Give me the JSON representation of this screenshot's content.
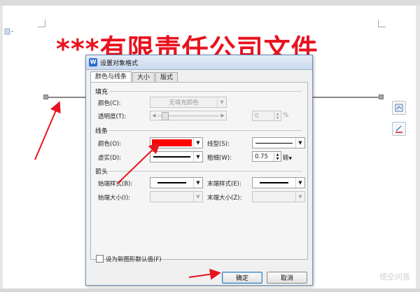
{
  "document": {
    "title_text": "***有限责任公司文件"
  },
  "dialog": {
    "title": "设置对象格式",
    "app_icon_letter": "W",
    "tabs": [
      {
        "label": "颜色与线条",
        "active": true
      },
      {
        "label": "大小",
        "active": false
      },
      {
        "label": "版式",
        "active": false
      }
    ],
    "fill": {
      "group_label": "填充",
      "color_label": "颜色(C):",
      "color_value": "无填充颜色",
      "transparency_label": "透明度(T):",
      "transparency_value": "0",
      "transparency_unit": "%"
    },
    "line": {
      "group_label": "线条",
      "color_label": "颜色(O):",
      "color_value": "#ff0000",
      "style_label": "线型(S):",
      "dash_label": "虚实(D):",
      "weight_label": "粗细(W):",
      "weight_value": "0.75",
      "weight_unit": "磅"
    },
    "arrows": {
      "group_label": "箭头",
      "begin_style_label": "始端样式(B):",
      "end_style_label": "末端样式(E):",
      "begin_size_label": "始端大小(I):",
      "end_size_label": "末端大小(Z):"
    },
    "default_checkbox_label": "设为新图形默认值(F)",
    "ok_label": "确定",
    "cancel_label": "取消"
  },
  "watermark": "悟空问答",
  "colors": {
    "title_red": "#e8131f",
    "annotation_arrow": "#e8131f",
    "line_color_swatch": "#ff0000"
  }
}
